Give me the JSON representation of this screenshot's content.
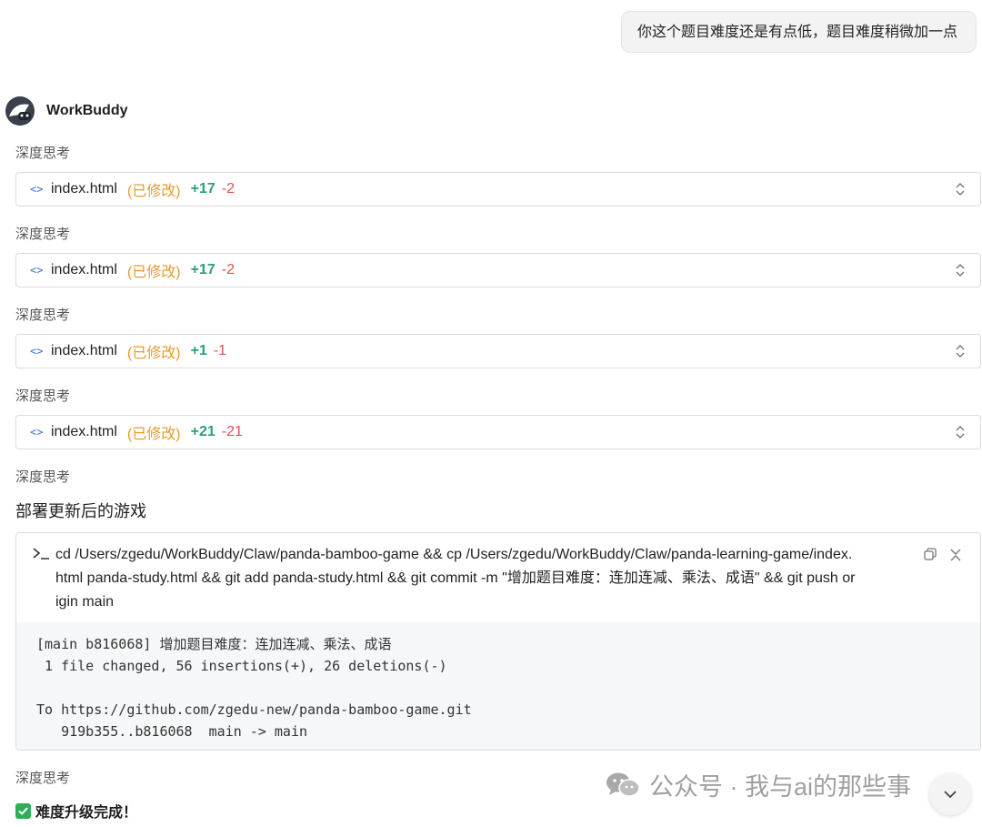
{
  "user_message": "你这个题目难度还是有点低，题目难度稍微加一点",
  "bot": {
    "name": "WorkBuddy"
  },
  "thinking_label": "深度思考",
  "file_changes": [
    {
      "filename": "index.html",
      "status": "(已修改)",
      "additions": "+17",
      "deletions": "-2"
    },
    {
      "filename": "index.html",
      "status": "(已修改)",
      "additions": "+17",
      "deletions": "-2"
    },
    {
      "filename": "index.html",
      "status": "(已修改)",
      "additions": "+1",
      "deletions": "-1"
    },
    {
      "filename": "index.html",
      "status": "(已修改)",
      "additions": "+21",
      "deletions": "-21"
    }
  ],
  "section_title": "部署更新后的游戏",
  "terminal": {
    "command_lines": [
      "cd /Users/zgedu/WorkBuddy/Claw/panda-bamboo-game && cp /Users/zgedu/WorkBuddy/Claw/panda-learning-game/index.",
      "html panda-study.html && git add panda-study.html && git commit -m \"增加题目难度：连加连减、乘法、成语\" && git push or",
      "igin main"
    ],
    "output_lines": [
      "[main b816068] 增加题目难度：连加连减、乘法、成语",
      " 1 file changed, 56 insertions(+), 26 deletions(-)",
      "",
      "To https://github.com/zgedu-new/panda-bamboo-game.git",
      "   919b355..b816068  main -> main"
    ]
  },
  "done_message": "难度升级完成！",
  "watermark": "公众号 · 我与ai的那些事",
  "colors": {
    "status": "#e89a2c",
    "additions": "#2ca07a",
    "deletions": "#e05050",
    "check": "#2eae55"
  },
  "icons": [
    "code-icon",
    "expand-collapse-icon",
    "terminal-prompt-icon",
    "copy-icon",
    "collapse-icon",
    "checkmark-icon",
    "wechat-icon",
    "chevron-down-icon"
  ]
}
